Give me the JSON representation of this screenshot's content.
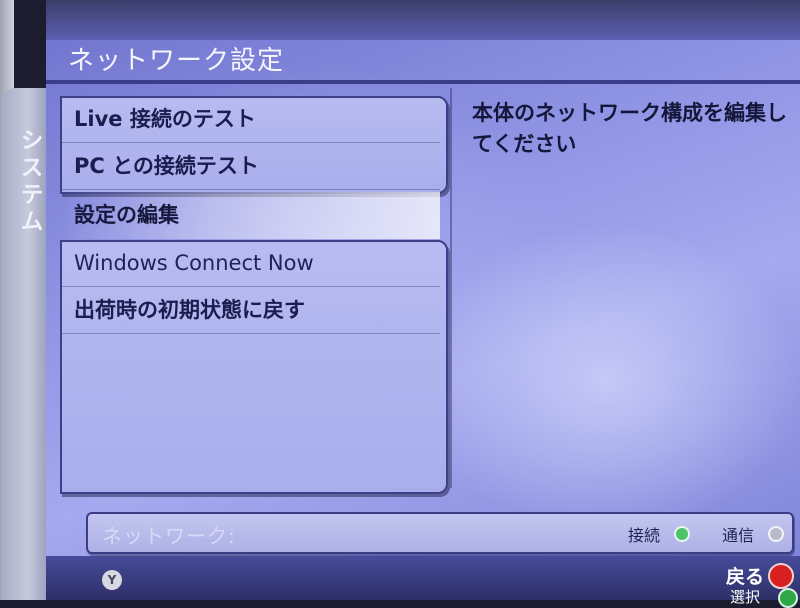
{
  "side_tab": {
    "label": "システム"
  },
  "header": {
    "title": "ネットワーク設定"
  },
  "menu": {
    "items": [
      {
        "label": "Live 接続のテスト",
        "selected": false
      },
      {
        "label": "PC との接続テスト",
        "selected": false
      },
      {
        "label": "設定の編集",
        "selected": true
      },
      {
        "label": "Windows Connect Now",
        "selected": false
      },
      {
        "label": "出荷時の初期状態に戻す",
        "selected": false
      }
    ]
  },
  "description": {
    "text": "本体のネットワーク構成を編集してください"
  },
  "status": {
    "label": "ネットワーク:",
    "connection_label": "接続",
    "connection_state": "green",
    "communication_label": "通信",
    "communication_state": "gray"
  },
  "controls": {
    "y_button_label": "Y",
    "back_label": "戻る",
    "back_button_color": "#d92020",
    "select_label": "選択",
    "select_button_color": "#2fa84a"
  }
}
